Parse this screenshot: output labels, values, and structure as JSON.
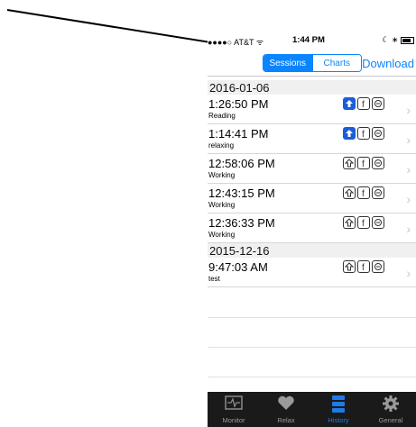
{
  "status": {
    "carrier": "●●●●○ AT&T ᯤ",
    "time": "1:44 PM",
    "right": "☾ ∗"
  },
  "nav": {
    "seg_sessions": "Sessions",
    "seg_charts": "Charts",
    "download": "Download"
  },
  "sections": [
    {
      "date": "2016-01-06"
    },
    {
      "date": "2015-12-16"
    }
  ],
  "rows": [
    {
      "time": "1:26:50 PM",
      "note": "Reading",
      "uploaded": true
    },
    {
      "time": "1:14:41 PM",
      "note": "relaxing",
      "uploaded": true
    },
    {
      "time": "12:58:06 PM",
      "note": "Working",
      "uploaded": false
    },
    {
      "time": "12:43:15 PM",
      "note": "Working",
      "uploaded": false
    },
    {
      "time": "12:36:33 PM",
      "note": "Working",
      "uploaded": false
    },
    {
      "time": "9:47:03 AM",
      "note": "test",
      "uploaded": false
    }
  ],
  "tabs": [
    {
      "label": "Monitor",
      "icon": "monitor-icon"
    },
    {
      "label": "Relax",
      "icon": "heart-icon"
    },
    {
      "label": "History",
      "icon": "history-icon",
      "active": true
    },
    {
      "label": "General",
      "icon": "gear-icon"
    }
  ],
  "colors": {
    "accent": "#0a84ff",
    "tabbar": "#1a1a1a",
    "active_tab": "#1e7ae6"
  }
}
